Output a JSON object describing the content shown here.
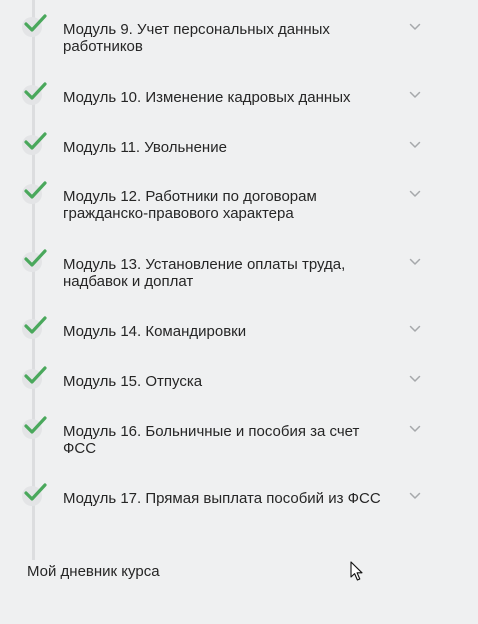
{
  "modules": [
    {
      "title": "Модуль 9. Учет персональных данных работников",
      "status": "completed",
      "expanded": false
    },
    {
      "title": "Модуль 10. Изменение кадровых данных",
      "status": "completed",
      "expanded": false
    },
    {
      "title": "Модуль 11. Увольнение",
      "status": "completed",
      "expanded": false
    },
    {
      "title": "Модуль 12. Работники по договорам гражданско-правового характера",
      "status": "completed",
      "expanded": false
    },
    {
      "title": "Модуль 13. Установление оплаты труда, надбавок и доплат",
      "status": "completed",
      "expanded": false
    },
    {
      "title": "Модуль 14. Командировки",
      "status": "completed",
      "expanded": false
    },
    {
      "title": "Модуль 15. Отпуска",
      "status": "completed",
      "expanded": false
    },
    {
      "title": "Модуль 16. Больничные и пособия за счет ФСС",
      "status": "completed",
      "expanded": false
    },
    {
      "title": "Модуль 17. Прямая выплата пособий из ФСС",
      "status": "completed",
      "expanded": false
    }
  ],
  "diary_link": "Мой дневник курса",
  "icons": {
    "status": "checkmark-icon",
    "toggle": "chevron-down-icon"
  },
  "colors": {
    "check": "#4aa85c",
    "check_circle": "#e3e4e6",
    "background": "#eff0f1",
    "chevron": "#a6a8ab"
  }
}
